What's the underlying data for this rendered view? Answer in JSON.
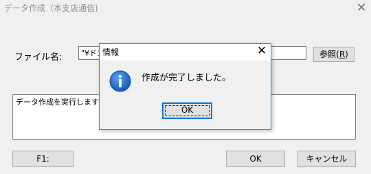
{
  "window": {
    "title": "データ作成（本支店通信)",
    "close_icon": "close-icon"
  },
  "form": {
    "file_label": "ファイル名:",
    "file_value": "\"¥ドコ",
    "browse_label": "参照(",
    "browse_accel": "R",
    "browse_close": ")",
    "log_text": "データ作成を実行します"
  },
  "buttons": {
    "f1": "F1:",
    "ok": "OK",
    "cancel": "キャンセル"
  },
  "dialog": {
    "title": "情報",
    "close_icon": "close-icon",
    "icon": "info-icon",
    "message": "作成が完了しました。",
    "ok": "OK"
  },
  "colors": {
    "dialog_border": "#3c7fb1",
    "info_icon": "#1e6fd0",
    "focus_border": "#0078d7"
  }
}
